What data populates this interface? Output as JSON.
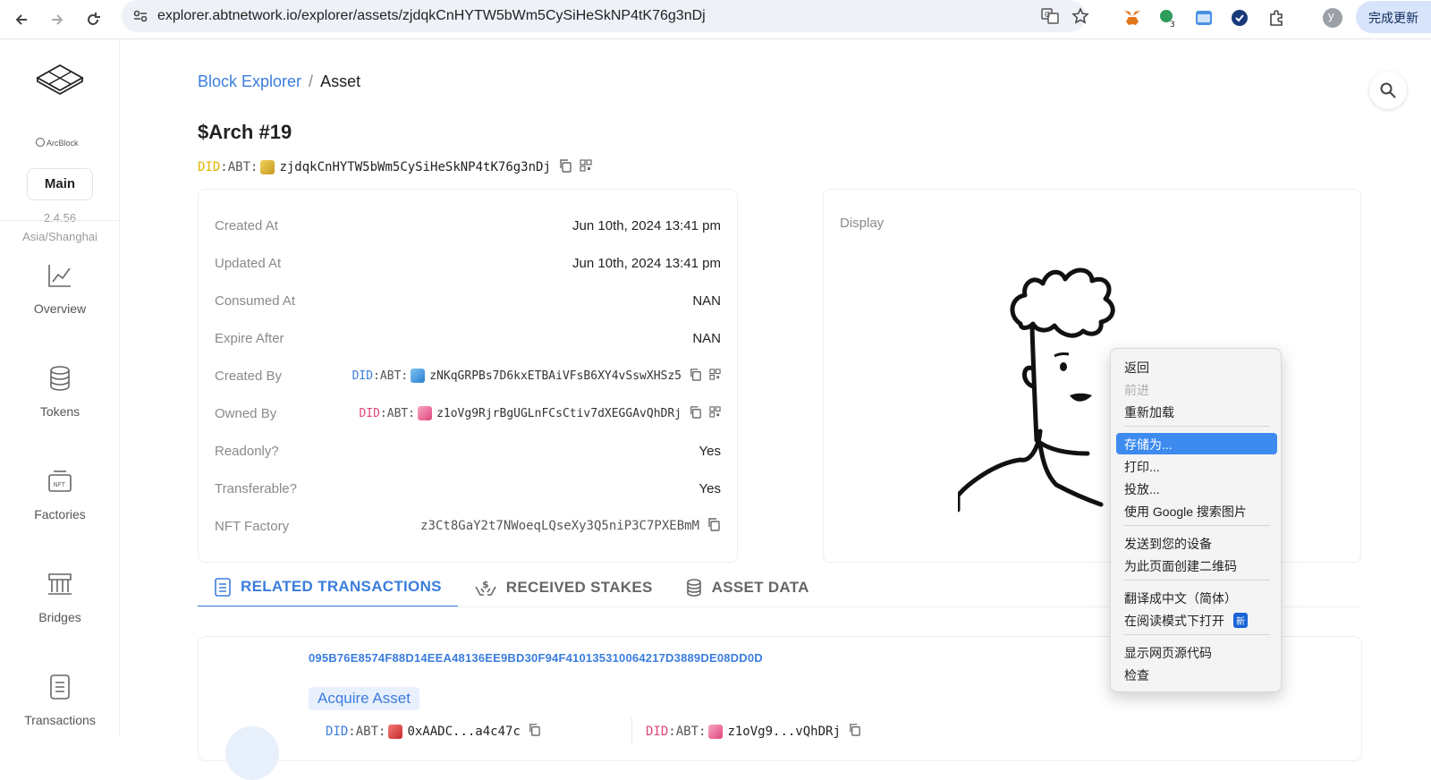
{
  "browser": {
    "url": "explorer.abtnetwork.io/explorer/assets/zjdqkCnHYTW5bWm5CySiHeSkNP4tK76g3nDj",
    "update_label": "完成更新",
    "ext_badge": "3",
    "profile_initial": "y"
  },
  "sidebar": {
    "logo_text": "ArcBlock",
    "network": "Main",
    "version": "2.4.56",
    "timezone": "Asia/Shanghai",
    "items": [
      {
        "label": "Overview",
        "icon": "chart-line-icon"
      },
      {
        "label": "Tokens",
        "icon": "database-icon"
      },
      {
        "label": "Factories",
        "icon": "nft-icon"
      },
      {
        "label": "Bridges",
        "icon": "bridge-icon"
      },
      {
        "label": "Transactions",
        "icon": "receipt-icon"
      }
    ]
  },
  "breadcrumb": {
    "root": "Block Explorer",
    "sep": "/",
    "current": "Asset"
  },
  "asset": {
    "title": "$Arch #19",
    "did_prefix": "DID",
    "did_mid": ":ABT:",
    "did": "zjdqkCnHYTW5bWm5CySiHeSkNP4tK76g3nDj"
  },
  "details": {
    "created_at_label": "Created At",
    "created_at": "Jun 10th, 2024 13:41 pm",
    "updated_at_label": "Updated At",
    "updated_at": "Jun 10th, 2024 13:41 pm",
    "consumed_at_label": "Consumed At",
    "consumed_at": "NAN",
    "expire_after_label": "Expire After",
    "expire_after": "NAN",
    "created_by_label": "Created By",
    "created_by_did": "zNKqGRPBs7D6kxETBAiVFsB6XY4vSswXHSz5",
    "owned_by_label": "Owned By",
    "owned_by_did": "z1oVg9RjrBgUGLnFCsCtiv7dXEGGAvQhDRj",
    "readonly_label": "Readonly?",
    "readonly": "Yes",
    "transferable_label": "Transferable?",
    "transferable": "Yes",
    "factory_label": "NFT Factory",
    "factory": "z3Ct8GaY2t7NWoeqLQseXy3Q5niP3C7PXEBmM"
  },
  "display": {
    "label": "Display"
  },
  "tabs": [
    {
      "label": "RELATED TRANSACTIONS",
      "active": true
    },
    {
      "label": "RECEIVED STAKES",
      "active": false
    },
    {
      "label": "ASSET DATA",
      "active": false
    }
  ],
  "transaction": {
    "hash": "095B76E8574F88D14EEA48136EE9BD30F94F410135310064217D3889DE08DD0D",
    "type": "Acquire Asset",
    "from": "0xAADC...a4c47c",
    "to": "z1oVg9...vQhDRj"
  },
  "context_menu": {
    "items": [
      {
        "label": "返回",
        "state": "normal"
      },
      {
        "label": "前进",
        "state": "disabled"
      },
      {
        "label": "重新加载",
        "state": "normal"
      },
      {
        "label": "存储为...",
        "state": "selected"
      },
      {
        "label": "打印...",
        "state": "normal"
      },
      {
        "label": "投放...",
        "state": "normal"
      },
      {
        "label": "使用 Google 搜索图片",
        "state": "normal"
      },
      {
        "label": "发送到您的设备",
        "state": "normal"
      },
      {
        "label": "为此页面创建二维码",
        "state": "normal"
      },
      {
        "label": "翻译成中文（简体）",
        "state": "normal"
      },
      {
        "label": "在阅读模式下打开",
        "state": "normal"
      },
      {
        "label": "显示网页源代码",
        "state": "normal"
      },
      {
        "label": "检查",
        "state": "normal"
      }
    ],
    "new_badge": "新"
  },
  "colors": {
    "accent": "#3b7ddd",
    "menu_highlight": "#3d8bef"
  }
}
